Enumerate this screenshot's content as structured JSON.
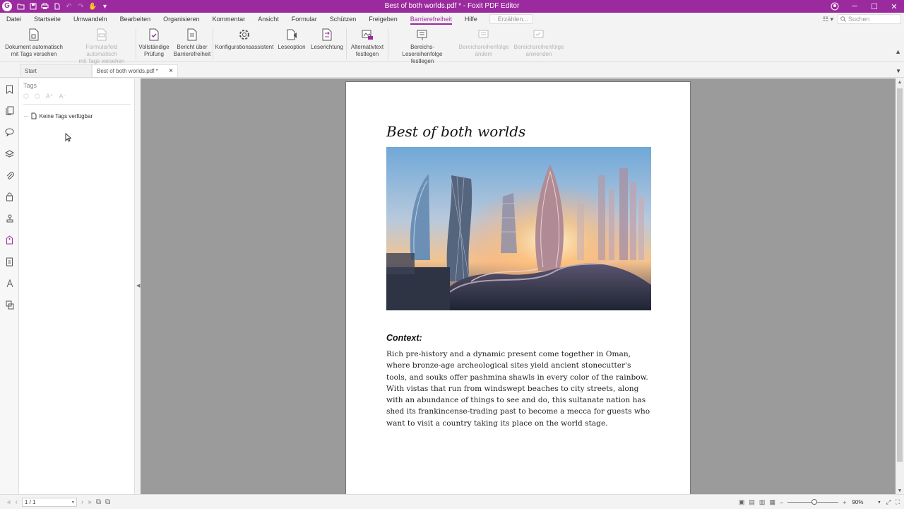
{
  "app": {
    "window_title": "Best of both worlds.pdf * - Foxit PDF Editor",
    "quick_access_dropdown": "▾"
  },
  "menu": {
    "items": [
      "Datei",
      "Startseite",
      "Umwandeln",
      "Bearbeiten",
      "Organisieren",
      "Kommentar",
      "Ansicht",
      "Formular",
      "Schützen",
      "Freigeben",
      "Barrierefreiheit",
      "Hilfe"
    ],
    "active": "Barrierefreiheit",
    "tellme_placeholder": "Erzählen...",
    "search_placeholder": "Suchen"
  },
  "ribbon": {
    "buttons": [
      {
        "label1": "Dokument automatisch",
        "label2": "mit Tags versehen",
        "enabled": true
      },
      {
        "label1": "Formularfeld automatisch",
        "label2": "mit Tags versehen",
        "enabled": false
      },
      {
        "label1": "Vollständige",
        "label2": "Prüfung",
        "enabled": true
      },
      {
        "label1": "Bericht über",
        "label2": "Barrierefreiheit",
        "enabled": true
      },
      {
        "label1": "Konfigurationsassistent",
        "label2": "",
        "enabled": true
      },
      {
        "label1": "Leseoption",
        "label2": "",
        "enabled": true
      },
      {
        "label1": "Leserichtung",
        "label2": "",
        "enabled": true
      },
      {
        "label1": "Alternativtext",
        "label2": "festlegen",
        "enabled": true
      },
      {
        "label1": "Bereichs-Lesereihenfolge",
        "label2": "festlegen",
        "enabled": true
      },
      {
        "label1": "Bereichsreihenfolge",
        "label2": "ändern",
        "enabled": false
      },
      {
        "label1": "Bereichsreihenfolge",
        "label2": "anwenden",
        "enabled": false
      }
    ]
  },
  "tabs": {
    "start": "Start",
    "document": "Best of both worlds.pdf *",
    "close": "×"
  },
  "tags_panel": {
    "title": "Tags",
    "empty_text": "Keine Tags verfügbar"
  },
  "document": {
    "title": "Best of both worlds",
    "context_heading": "Context:",
    "paragraph1": "Rich pre-history and a dynamic present come together in Oman, where bronze-age archeological sites yield ancient stonecutter's tools, and souks offer pashmina shawls in every color of the rainbow.",
    "paragraph2": "With vistas that run from windswept beaches to city streets, along with an abundance of things to see and do, this sultanate nation has shed its frankincense-trading past to become a mecca for guests who want to visit a country taking its place on the world stage."
  },
  "status": {
    "page_indicator": "1 / 1",
    "zoom": "90%"
  },
  "colors": {
    "brand": "#9b2a9e",
    "workarea": "#9b9b9b"
  }
}
